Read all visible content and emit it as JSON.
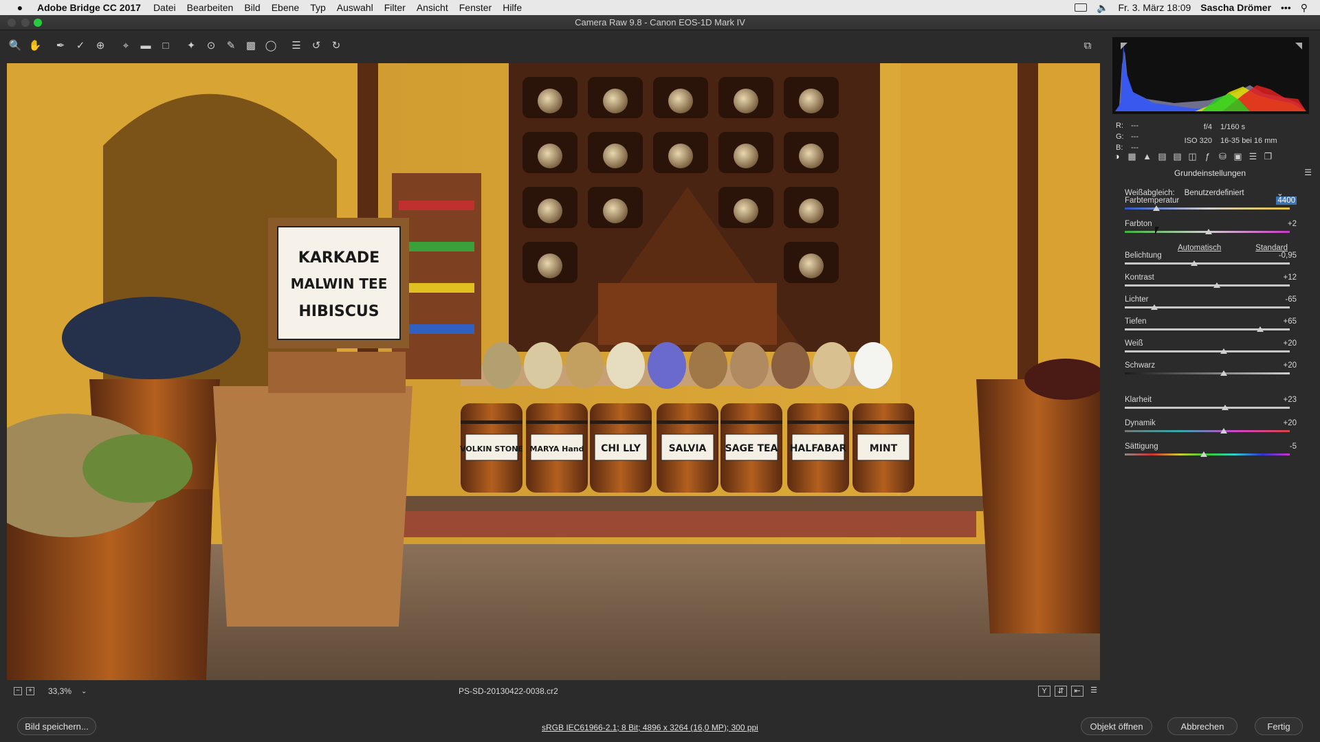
{
  "menubar": {
    "app": "Adobe Bridge CC 2017",
    "menus": [
      "Datei",
      "Bearbeiten",
      "Bild",
      "Ebene",
      "Typ",
      "Auswahl",
      "Filter",
      "Ansicht",
      "Fenster",
      "Hilfe"
    ],
    "datetime": "Fr. 3. März  18:09",
    "user": "Sascha Drömer"
  },
  "window": {
    "title": "Camera Raw 9.8  -  Canon EOS-1D Mark IV"
  },
  "image": {
    "sign": [
      "KARKADE",
      "MALWIN TEE",
      "HIBISCUS"
    ],
    "barrels": [
      "VOLKIN STONE",
      "MARYA Hand",
      "CHI LLY",
      "SALVIA",
      "SAGE TEA",
      "HALFABAR",
      "MINT"
    ]
  },
  "preview": {
    "zoom": "33,3%",
    "filename": "PS-SD-20130422-0038.cr2"
  },
  "info": {
    "r": "---",
    "g": "---",
    "b": "---",
    "aperture": "f/4",
    "shutter": "1/160 s",
    "iso": "ISO 320",
    "lens": "16-35 bei 16 mm"
  },
  "panel": {
    "section_title": "Grundeinstellungen",
    "wb_label": "Weißabgleich:",
    "wb_value": "Benutzerdefiniert",
    "auto": "Automatisch",
    "standard": "Standard",
    "sliders": [
      {
        "label": "Farbtemperatur",
        "value": "4400",
        "pos": 0.19
      },
      {
        "label": "Farbton",
        "value": "+2",
        "pos": 0.51
      },
      {
        "label": "Belichtung",
        "value": "-0,95",
        "pos": 0.42
      },
      {
        "label": "Kontrast",
        "value": "+12",
        "pos": 0.56
      },
      {
        "label": "Lichter",
        "value": "-65",
        "pos": 0.18
      },
      {
        "label": "Tiefen",
        "value": "+65",
        "pos": 0.82
      },
      {
        "label": "Weiß",
        "value": "+20",
        "pos": 0.6
      },
      {
        "label": "Schwarz",
        "value": "+20",
        "pos": 0.6
      },
      {
        "label": "Klarheit",
        "value": "+23",
        "pos": 0.61
      },
      {
        "label": "Dynamik",
        "value": "+20",
        "pos": 0.6
      },
      {
        "label": "Sättigung",
        "value": "-5",
        "pos": 0.48
      }
    ]
  },
  "footer": {
    "save": "Bild speichern...",
    "workflow": "sRGB IEC61966-2.1; 8 Bit; 4896 x 3264 (16,0 MP); 300 ppi",
    "open": "Objekt öffnen",
    "cancel": "Abbrechen",
    "done": "Fertig"
  }
}
